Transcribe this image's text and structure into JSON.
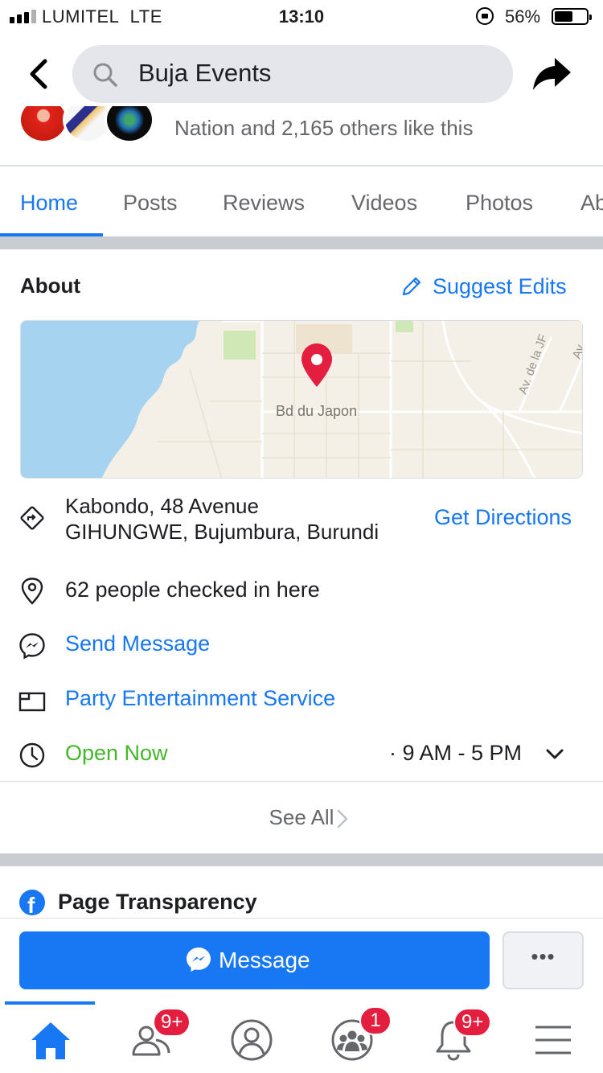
{
  "status_bar": {
    "carrier": "LUMITEL",
    "network": "LTE",
    "time": "13:10",
    "battery_percent": "56%",
    "battery_level": 0.56
  },
  "header": {
    "search_text": "Buja Events",
    "back_icon": "back-chevron-icon",
    "share_icon": "share-arrow-icon"
  },
  "likes": {
    "text": "Nation and 2,165 others like this"
  },
  "tabs": [
    {
      "label": "Home",
      "active": true
    },
    {
      "label": "Posts"
    },
    {
      "label": "Reviews"
    },
    {
      "label": "Videos"
    },
    {
      "label": "Photos"
    },
    {
      "label": "Ab"
    }
  ],
  "about": {
    "title": "About",
    "suggest_edits": "Suggest Edits",
    "map": {
      "street_label": "Bd du Japon",
      "avenue_label_1": "Av. de la JF",
      "avenue_label_2": "Av"
    },
    "address_line1": "Kabondo, 48 Avenue",
    "address_line2": "GIHUNGWE, Bujumbura, Burundi",
    "get_directions": "Get Directions",
    "checked_in": "62 people checked in here",
    "send_message": "Send Message",
    "category": "Party Entertainment Service",
    "open_now": "Open Now",
    "hours": "· 9 AM - 5 PM",
    "see_all": "See All"
  },
  "transparency": {
    "title": "Page Transparency"
  },
  "actions": {
    "message": "Message",
    "more": "•••"
  },
  "bottom_nav": {
    "friends_badge": "9+",
    "groups_badge": "1",
    "notifications_badge": "9+"
  },
  "colors": {
    "accent": "#1877f2",
    "open_green": "#42b72a",
    "badge_red": "#e41e3f",
    "map_water": "#a5d3f0",
    "map_land": "#f4f0e8"
  }
}
